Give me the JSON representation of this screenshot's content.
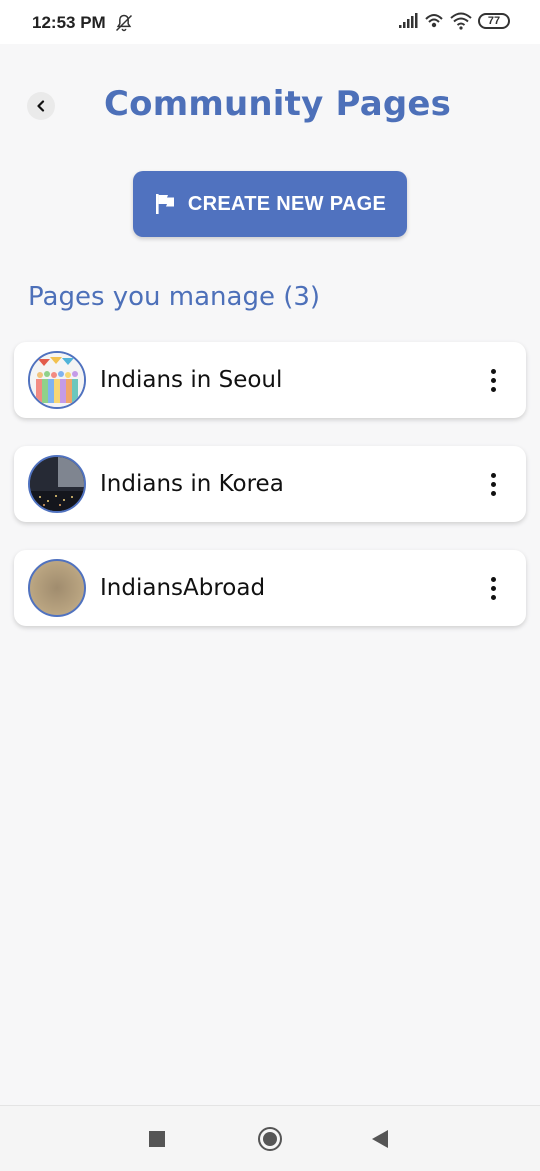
{
  "status_bar": {
    "time": "12:53 PM",
    "battery": "77"
  },
  "header": {
    "title": "Community Pages"
  },
  "actions": {
    "create_label": "CREATE NEW PAGE"
  },
  "section": {
    "heading": "Pages you manage (3)"
  },
  "pages": [
    {
      "name": "Indians in Seoul"
    },
    {
      "name": "Indians in Korea"
    },
    {
      "name": "IndiansAbroad"
    }
  ],
  "colors": {
    "accent": "#4d70b9",
    "button_bg": "#5072bf",
    "background": "#f7f7f8"
  },
  "icons": {
    "back": "chevron-left-icon",
    "flag": "flag-icon",
    "more": "more-vertical-icon",
    "mute": "bell-off-icon",
    "signal": "signal-icon",
    "wifi": "wifi-icon"
  }
}
